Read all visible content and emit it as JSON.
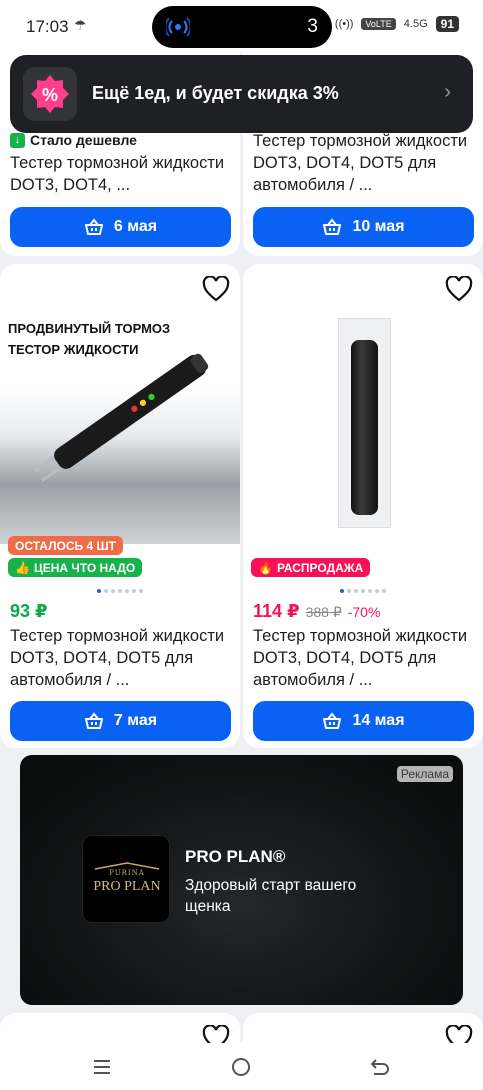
{
  "status_bar": {
    "time": "17:03",
    "notification_count": "3",
    "signal_label": "VoLTE",
    "network": "4.5G",
    "battery": "91"
  },
  "toast": {
    "text": "Ещё 1ед, и будет скидка 3%",
    "badge_icon": "percent-star-icon",
    "accent": "#ff3d8b"
  },
  "top_cards": [
    {
      "badge": "Стало дешевле",
      "title": "Тестер тормозной жидкости DOT3, DOT4, ...",
      "delivery": "6 мая"
    },
    {
      "title": "Тестер тормозной жидкости DOT3, DOT4, DOT5 для автомобиля / ...",
      "delivery": "10 мая"
    }
  ],
  "products": [
    {
      "image_caption": "ПРОДВИНУТЫЙ ТОРМОЗ ТЕСТОР ЖИДКОСТИ",
      "tags": [
        "ОСТАЛОСЬ 4 ШТ",
        "ЦЕНА ЧТО НАДО"
      ],
      "price": "93 ₽",
      "title": "Тестер тормозной жидкости DOT3, DOT4, DOT5 для автомобиля / ...",
      "delivery": "7 мая"
    },
    {
      "tags": [
        "РАСПРОДАЖА"
      ],
      "price": "114 ₽",
      "old_price": "388 ₽",
      "discount": "-70%",
      "title": "Тестер тормозной жидкости DOT3, DOT4, DOT5 для автомобиля / ...",
      "delivery": "14 мая"
    }
  ],
  "ad": {
    "label": "Реклама",
    "logo_top": "PURINA",
    "logo_text": "PRO PLAN",
    "title": "PRO PLAN®",
    "subtitle": "Здоровый старт вашего щенка"
  },
  "colors": {
    "primary_button": "#0a62f5",
    "price_green": "#0ea84b",
    "sale_pink": "#f91155"
  }
}
